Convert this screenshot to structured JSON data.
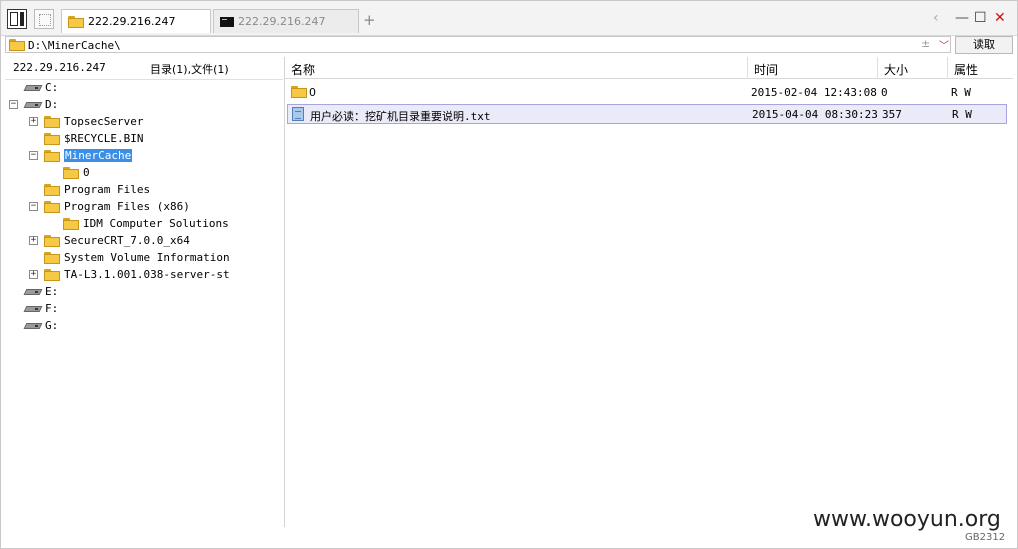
{
  "tabs": [
    {
      "label": "222.29.216.247",
      "active": true,
      "icon": "folder-icon"
    },
    {
      "label": "222.29.216.247",
      "active": false,
      "icon": "terminal-icon"
    }
  ],
  "tab_add": "+",
  "window_controls": {
    "back": "‹",
    "minimize": "—",
    "maximize": "☐",
    "close": "✕"
  },
  "path": {
    "value": "D:\\MinerCache\\",
    "up": "±",
    "dropdown": "﹀"
  },
  "read_button": "读取",
  "left_header": {
    "host": "222.29.216.247",
    "counts": "目录(1),文件(1)"
  },
  "columns": {
    "name": "名称",
    "time": "时间",
    "size": "大小",
    "attr": "属性"
  },
  "tree": [
    {
      "label": "C:",
      "icon": "drive",
      "toggle": ""
    },
    {
      "label": "D:",
      "icon": "drive",
      "toggle": "−"
    },
    {
      "label": "TopsecServer",
      "icon": "folder",
      "toggle": "+"
    },
    {
      "label": "$RECYCLE.BIN",
      "icon": "folder",
      "toggle": ""
    },
    {
      "label": "MinerCache",
      "icon": "folder",
      "toggle": "−",
      "selected": true
    },
    {
      "label": "0",
      "icon": "folder",
      "toggle": ""
    },
    {
      "label": "Program Files",
      "icon": "folder",
      "toggle": ""
    },
    {
      "label": "Program Files (x86)",
      "icon": "folder",
      "toggle": "−"
    },
    {
      "label": "IDM Computer Solutions",
      "icon": "folder",
      "toggle": ""
    },
    {
      "label": "SecureCRT_7.0.0_x64",
      "icon": "folder",
      "toggle": "+"
    },
    {
      "label": "System Volume Information",
      "icon": "folder",
      "toggle": ""
    },
    {
      "label": "TA-L3.1.001.038-server-st",
      "icon": "folder",
      "toggle": "+"
    },
    {
      "label": "E:",
      "icon": "drive",
      "toggle": ""
    },
    {
      "label": "F:",
      "icon": "drive",
      "toggle": ""
    },
    {
      "label": "G:",
      "icon": "drive",
      "toggle": ""
    }
  ],
  "files": [
    {
      "name": "0",
      "time": "2015-02-04 12:43:08",
      "size": "0",
      "attr": "R W",
      "icon": "folder"
    },
    {
      "name_cn": "用户必读：挖矿机目录重要说明",
      "name_ext": ".txt",
      "time": "2015-04-04 08:30:23",
      "size": "357",
      "attr": "R W",
      "icon": "txt-file",
      "selected": true
    }
  ],
  "watermark": "www.wooyun.org",
  "encoding": "GB2312",
  "colors": {
    "selection": "#3b8fe6",
    "row_selected_bg": "#eaeaf8",
    "folder": "#f6c945",
    "close": "#d01010"
  }
}
